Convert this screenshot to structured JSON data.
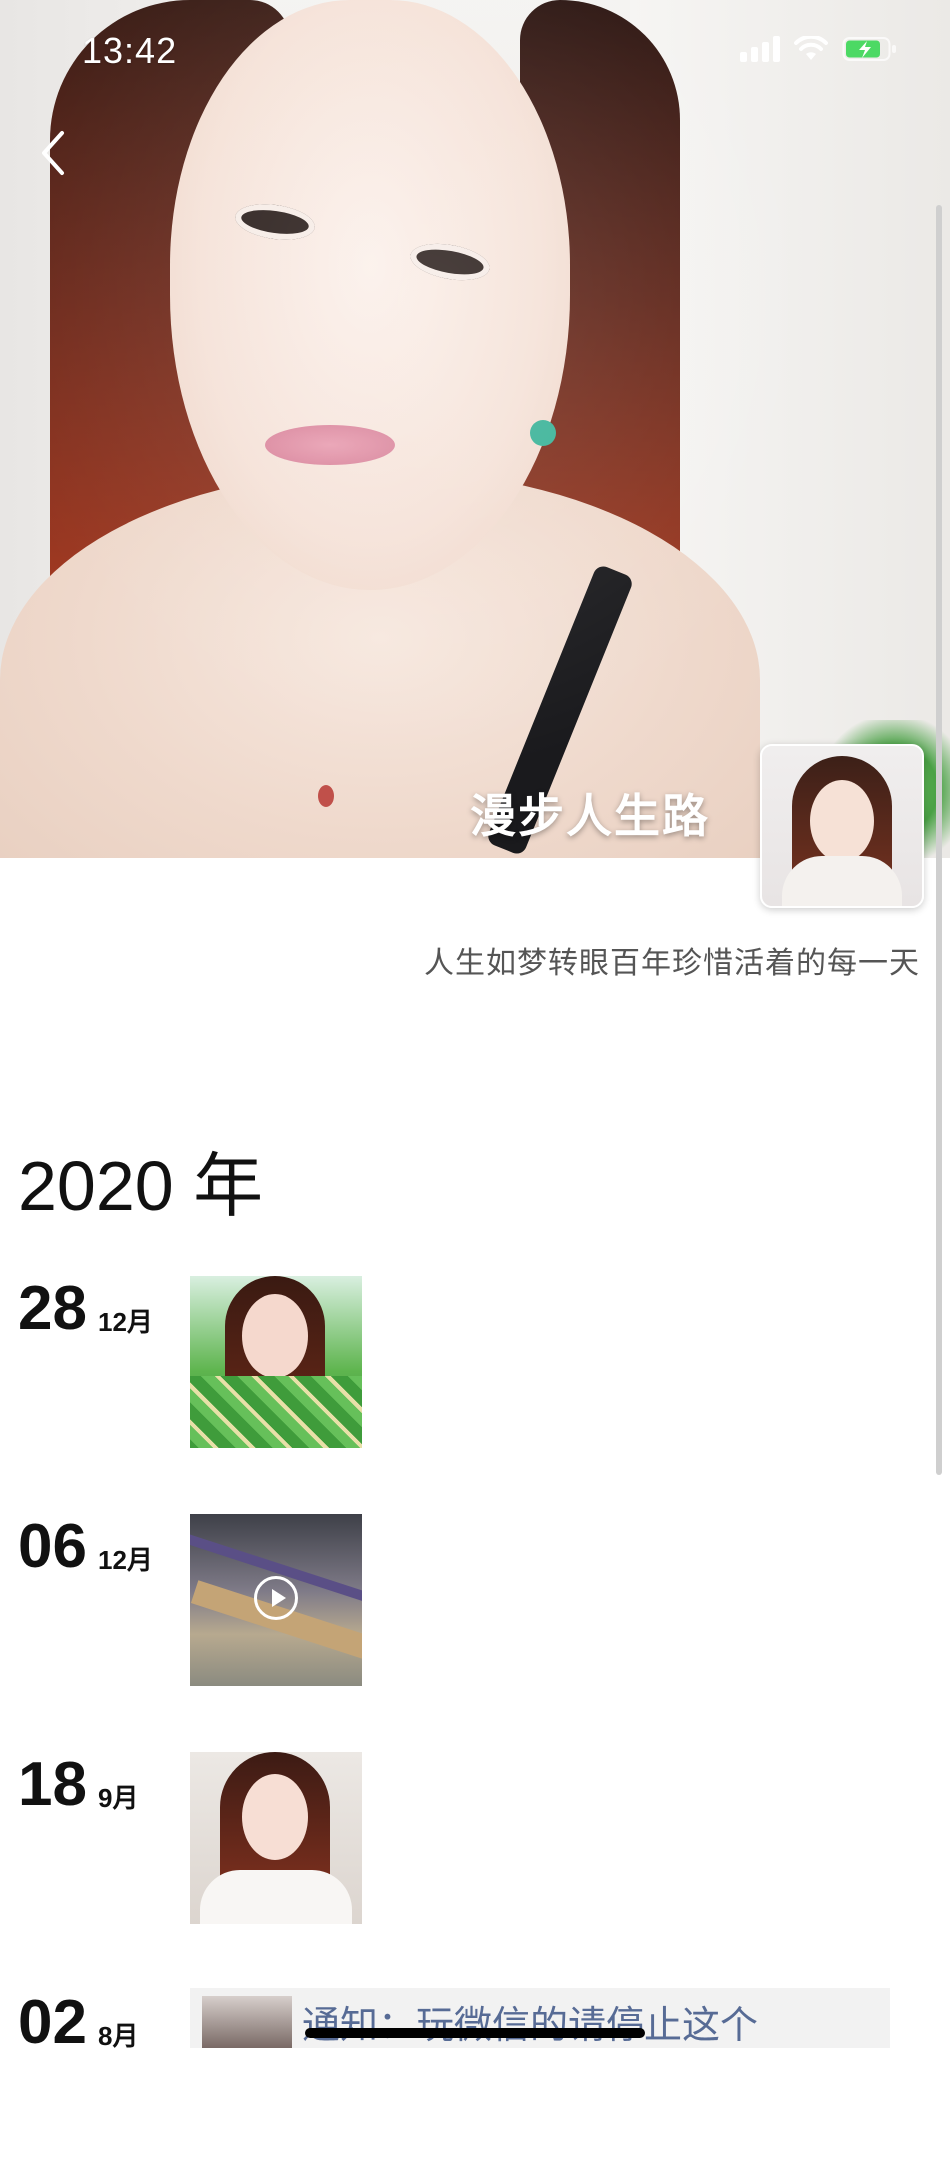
{
  "status_bar": {
    "time": "13:42"
  },
  "profile": {
    "name": "漫步人生路",
    "signature": "人生如梦转眼百年珍惜活着的每一天"
  },
  "timeline": {
    "year": "2020 年",
    "posts": [
      {
        "day": "28",
        "month": "12月",
        "media": "photo"
      },
      {
        "day": "06",
        "month": "12月",
        "media": "video"
      },
      {
        "day": "18",
        "month": "9月",
        "media": "photo"
      },
      {
        "day": "02",
        "month": "8月",
        "media": "shared-link",
        "share_text": "通知：玩微信的请停止这个"
      }
    ]
  },
  "icons": {
    "back": "chevron-left-icon",
    "signal": "signal-icon",
    "wifi": "wifi-icon",
    "battery": "battery-charging-icon",
    "play": "play-icon"
  },
  "colors": {
    "link": "#576b95",
    "text": "#111111",
    "signature": "#555555"
  }
}
